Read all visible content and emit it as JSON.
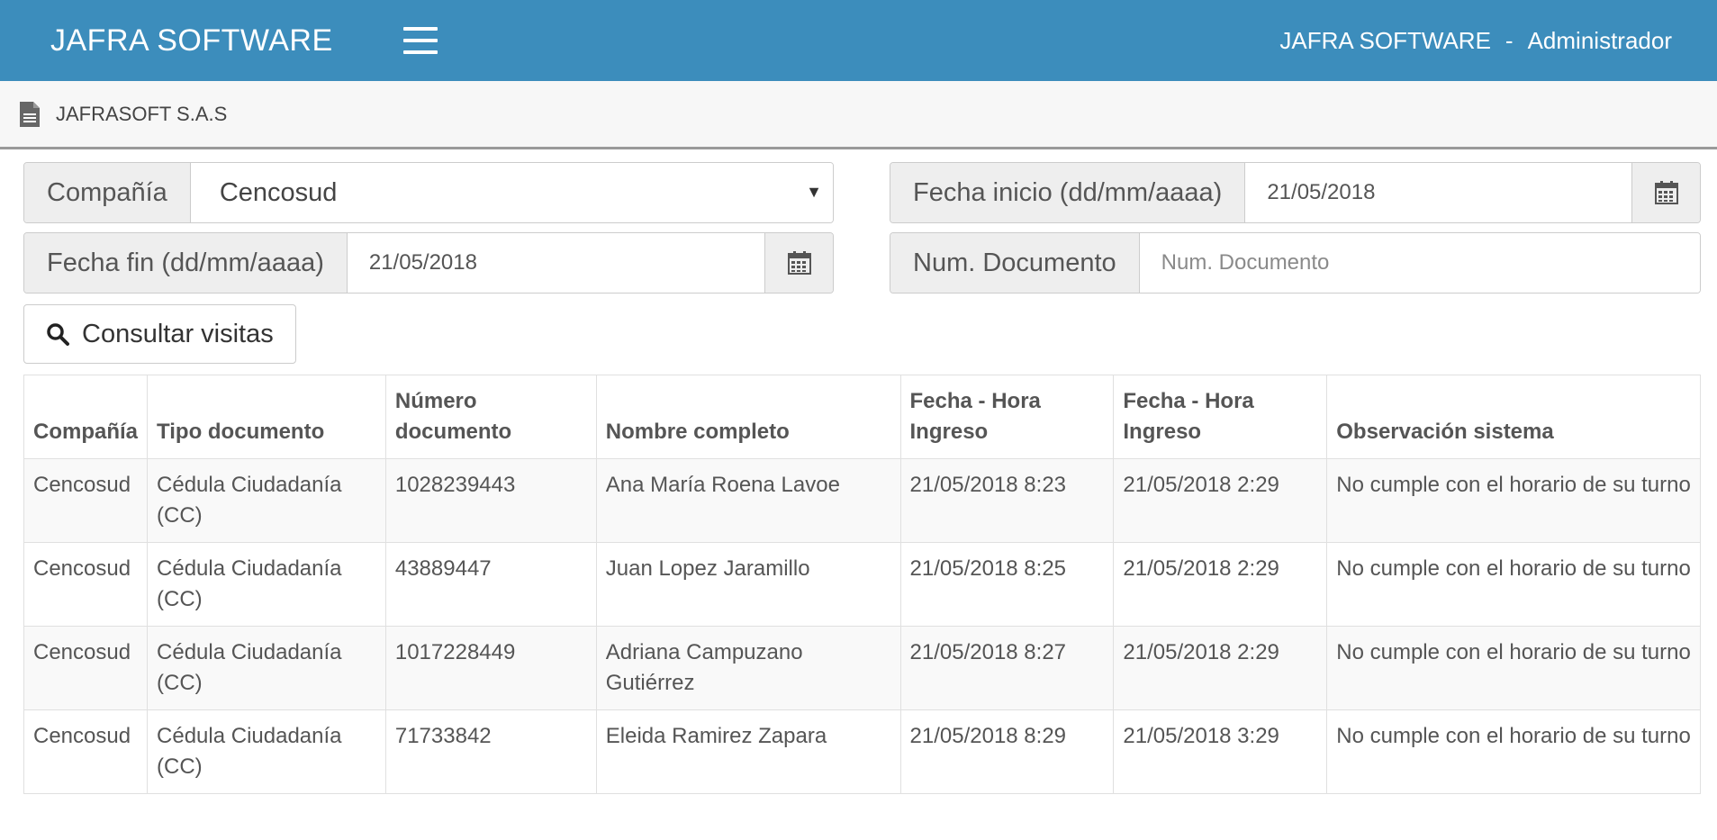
{
  "navbar": {
    "brand": "JAFRA SOFTWARE",
    "user_company": "JAFRA SOFTWARE",
    "separator": "-",
    "user_role": "Administrador",
    "bg_color": "#3c8dbc"
  },
  "breadcrumb": {
    "icon": "document-icon",
    "company": "JAFRASOFT S.A.S"
  },
  "form": {
    "company_label": "Compañía",
    "company_value": "Cencosud",
    "start_date_label": "Fecha inicio (dd/mm/aaaa)",
    "start_date_value": "21/05/2018",
    "end_date_label": "Fecha fin (dd/mm/aaaa)",
    "end_date_value": "21/05/2018",
    "doc_num_label": "Num. Documento",
    "doc_num_placeholder": "Num. Documento",
    "submit_label": "Consultar visitas"
  },
  "table": {
    "headers": {
      "company": "Compañía",
      "doc_type": "Tipo documento",
      "doc_num": "Número documento",
      "full_name": "Nombre completo",
      "entry_1": "Fecha - Hora Ingreso",
      "entry_2": "Fecha - Hora Ingreso",
      "observation": "Observación sistema"
    },
    "rows": [
      {
        "company": "Cencosud",
        "doc_type": "Cédula Ciudadanía (CC)",
        "doc_num": "1028239443",
        "full_name": "Ana María Roena Lavoe",
        "entry_1": "21/05/2018 8:23",
        "entry_2": "21/05/2018 2:29",
        "observation": "No cumple con el horario de su turno"
      },
      {
        "company": "Cencosud",
        "doc_type": "Cédula Ciudadanía (CC)",
        "doc_num": "43889447",
        "full_name": "Juan Lopez Jaramillo",
        "entry_1": "21/05/2018 8:25",
        "entry_2": "21/05/2018 2:29",
        "observation": "No cumple con el horario de su turno"
      },
      {
        "company": "Cencosud",
        "doc_type": "Cédula Ciudadanía (CC)",
        "doc_num": "1017228449",
        "full_name": "Adriana Campuzano Gutiérrez",
        "entry_1": "21/05/2018 8:27",
        "entry_2": "21/05/2018 2:29",
        "observation": "No cumple con el horario de su turno"
      },
      {
        "company": "Cencosud",
        "doc_type": "Cédula Ciudadanía (CC)",
        "doc_num": "71733842",
        "full_name": "Eleida Ramirez Zapara",
        "entry_1": "21/05/2018 8:29",
        "entry_2": "21/05/2018 3:29",
        "observation": "No cumple con el horario de su turno"
      }
    ]
  }
}
